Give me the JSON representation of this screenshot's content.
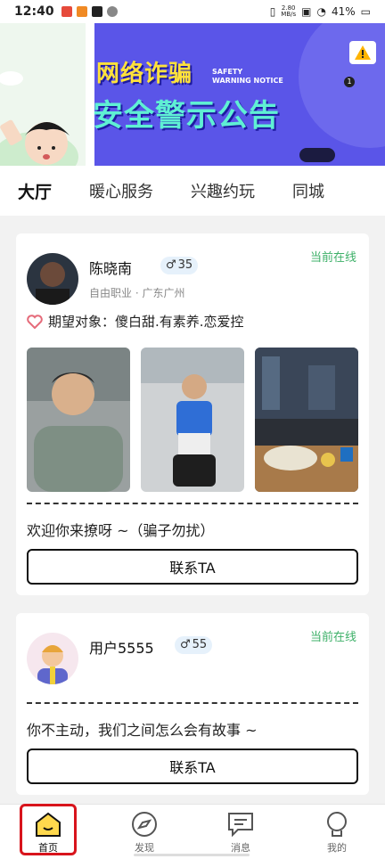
{
  "status_bar": {
    "time": "12:40",
    "net_speed": "2.80",
    "net_unit": "MB/s",
    "battery": "41%"
  },
  "banner": {
    "title_line1": "网络诈骗",
    "title_line2": "安全警示公告",
    "subtitle_line1": "SAFETY",
    "subtitle_line2": "WARNING NOTICE",
    "page_indicator": "1"
  },
  "tabs": [
    {
      "label": "大厅",
      "active": true
    },
    {
      "label": "暖心服务",
      "active": false
    },
    {
      "label": "兴趣约玩",
      "active": false
    },
    {
      "label": "同城",
      "active": false
    }
  ],
  "cards": [
    {
      "name": "陈晓南",
      "age": "35",
      "online": "当前在线",
      "meta": "自由职业 · 广东广州",
      "expect": "期望对象：傻白甜.有素养.恋爱控",
      "intro": "欢迎你来撩呀 ~（骗子勿扰）",
      "button": "联系TA"
    },
    {
      "name": "用户5555",
      "age": "55",
      "online": "当前在线",
      "intro": "你不主动，我们之间怎么会有故事 ~",
      "button": "联系TA"
    }
  ],
  "bottom_nav": [
    {
      "label": "首页",
      "icon": "home-icon"
    },
    {
      "label": "发现",
      "icon": "compass-icon"
    },
    {
      "label": "消息",
      "icon": "message-icon"
    },
    {
      "label": "我的",
      "icon": "profile-icon"
    }
  ],
  "colors": {
    "accent_yellow": "#ffd84d",
    "online_green": "#3db068",
    "highlight_red": "#d8141c",
    "banner_purple": "#5a55e8"
  }
}
